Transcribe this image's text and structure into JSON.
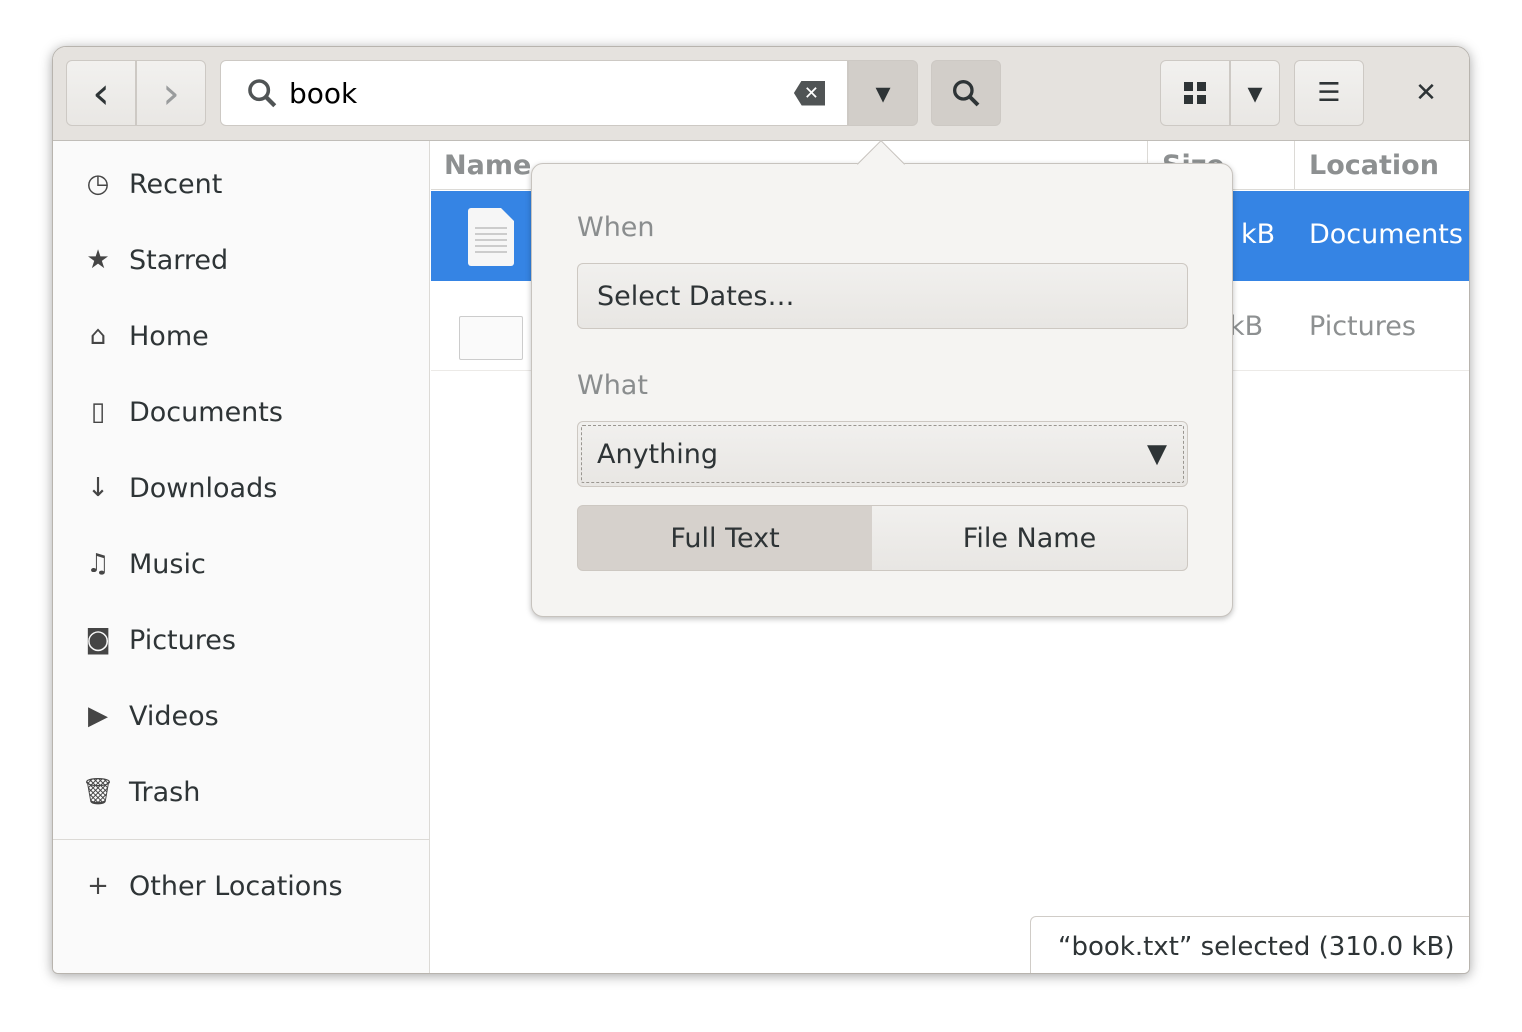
{
  "toolbar": {
    "back": "‹",
    "forward": "›",
    "search_value": "book",
    "clear_icon": "⌫",
    "search_options_icon": "▾",
    "search_icon": "search-icon",
    "view_grid_icon": "grid-icon",
    "view_options_icon": "▾",
    "menu_icon": "☰",
    "close": "✕"
  },
  "sidebar": {
    "items": [
      {
        "label": "Recent",
        "icon": "◷"
      },
      {
        "label": "Starred",
        "icon": "★"
      },
      {
        "label": "Home",
        "icon": "⌂"
      },
      {
        "label": "Documents",
        "icon": "▯"
      },
      {
        "label": "Downloads",
        "icon": "↓"
      },
      {
        "label": "Music",
        "icon": "♫"
      },
      {
        "label": "Pictures",
        "icon": "◙"
      },
      {
        "label": "Videos",
        "icon": "▶"
      },
      {
        "label": "Trash",
        "icon": "🗑"
      }
    ],
    "other": {
      "label": "Other Locations",
      "icon": "+"
    }
  },
  "columns": {
    "name": "Name",
    "size": "Size",
    "location": "Location"
  },
  "files": [
    {
      "size": "kB",
      "location": "Documents"
    },
    {
      "size": "kB",
      "location": "Pictures"
    }
  ],
  "popover": {
    "when_label": "When",
    "select_dates": "Select Dates…",
    "what_label": "What",
    "what_value": "Anything",
    "full_text": "Full Text",
    "file_name": "File Name"
  },
  "status": "“book.txt” selected  (310.0 kB)",
  "colors": {
    "selection": "#3584e4",
    "header": "#e5e2de"
  }
}
